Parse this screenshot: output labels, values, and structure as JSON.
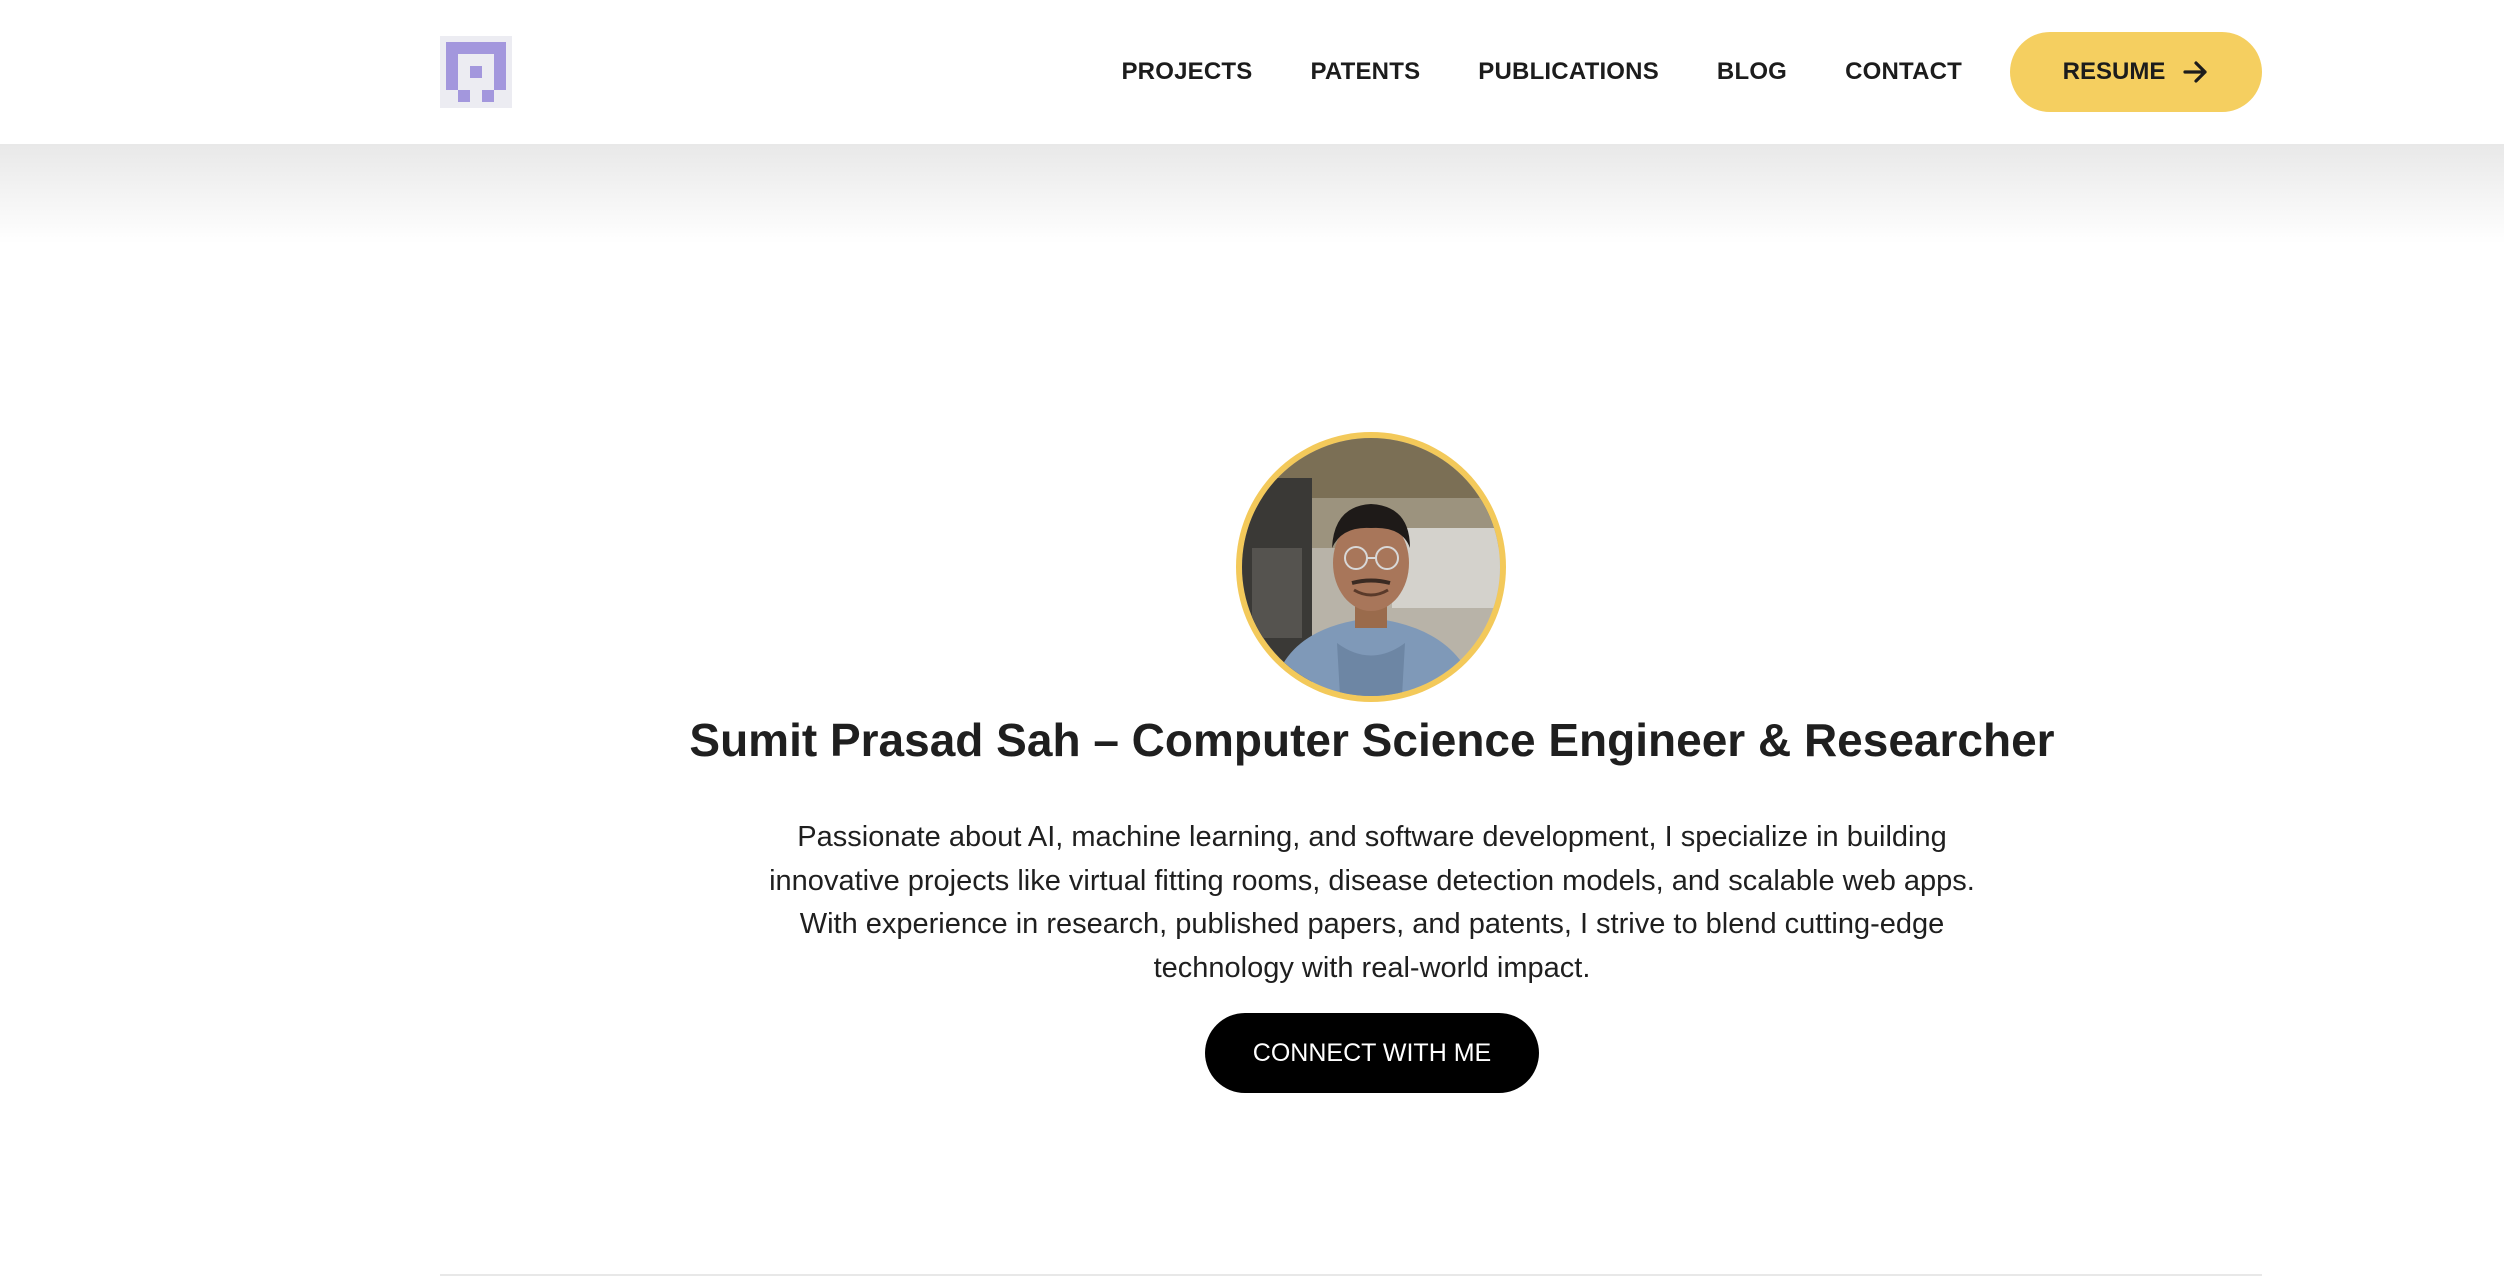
{
  "header": {
    "logo_icon": "pixel-logo-icon",
    "nav": [
      {
        "label": "PROJECTS"
      },
      {
        "label": "PATENTS"
      },
      {
        "label": "PUBLICATIONS"
      },
      {
        "label": "BLOG"
      },
      {
        "label": "CONTACT"
      }
    ],
    "resume_label": "RESUME",
    "resume_icon": "arrow-right-icon"
  },
  "hero": {
    "avatar_icon": "profile-photo",
    "title": "Sumit Prasad Sah – Computer Science Engineer & Researcher",
    "description": "Passionate about AI, machine learning, and software development, I specialize in building innovative projects like virtual fitting rooms, disease detection models, and scalable web apps. With experience in research, published papers, and patents, I strive to blend cutting-edge technology with real-world impact.",
    "cta_label": "CONNECT WITH ME"
  },
  "colors": {
    "accent": "#f5cf60",
    "logo": "#a397dd",
    "cta_background": "#000000",
    "text": "#1c1c1c"
  }
}
